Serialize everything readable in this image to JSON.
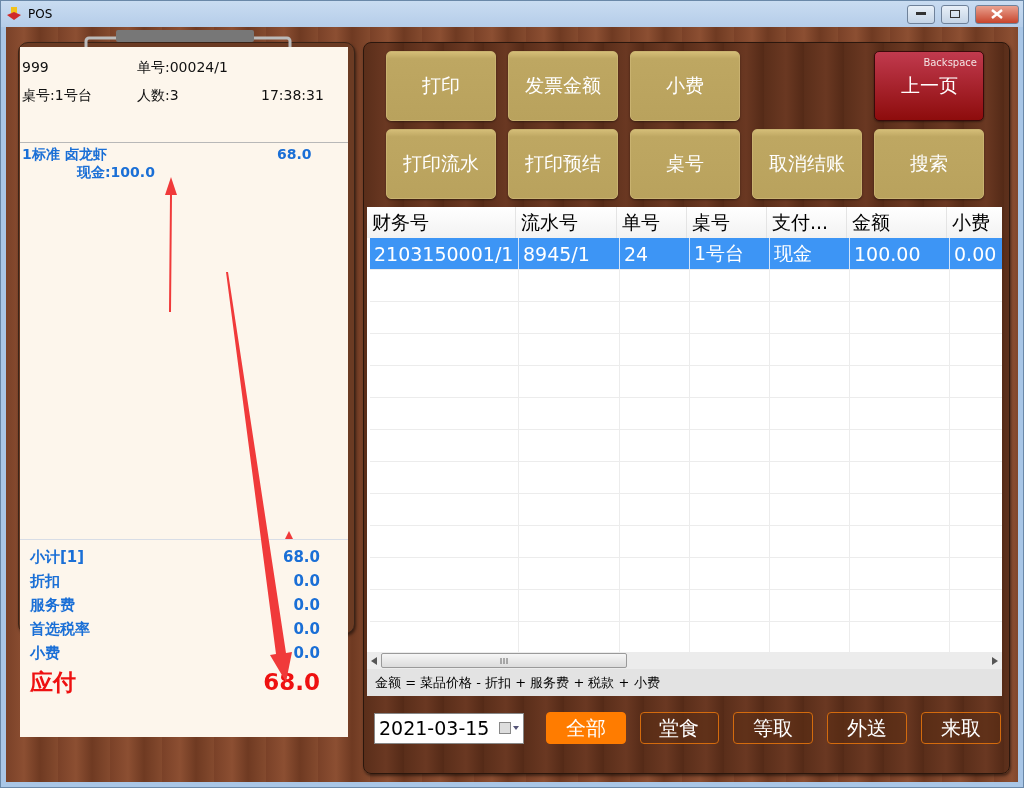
{
  "window": {
    "title": "POS"
  },
  "receipt": {
    "header": [
      {
        "text": "999"
      },
      {
        "text": "单号:00024/1"
      }
    ],
    "header_row_2": [
      "桌号:1号台",
      "人数:3",
      "17:38:31"
    ],
    "items": [
      {
        "name": "1标准 卤龙虾",
        "price": "68.0",
        "payment": "现金:100.0"
      }
    ],
    "totals": [
      {
        "label": "小计[1]",
        "value": "68.0"
      },
      {
        "label": "折扣",
        "value": "0.0"
      },
      {
        "label": "服务费",
        "value": "0.0"
      },
      {
        "label": "首选税率",
        "value": "0.0"
      },
      {
        "label": "小费",
        "value": "0.0"
      }
    ],
    "due": {
      "label": "应付",
      "value": "68.0"
    }
  },
  "buttons": [
    {
      "label": "打印",
      "kind": "normal"
    },
    {
      "label": "发票金额",
      "kind": "normal"
    },
    {
      "label": "小费",
      "kind": "normal"
    },
    {
      "kind": "gap"
    },
    {
      "label": "上一页",
      "kind": "danger",
      "hint": "Backspace"
    },
    {
      "label": "打印流水",
      "kind": "normal"
    },
    {
      "label": "打印预结",
      "kind": "normal"
    },
    {
      "label": "桌号",
      "kind": "normal"
    },
    {
      "label": "取消结账",
      "kind": "normal"
    },
    {
      "label": "搜索",
      "kind": "normal"
    }
  ],
  "table": {
    "columns": [
      "财务号",
      "流水号",
      "单号",
      "桌号",
      "支付...",
      "金额",
      "小费"
    ],
    "rows": [
      {
        "cells": [
          "2103150001/1",
          "8945/1",
          "24",
          "1号台",
          "现金",
          "100.00",
          "0.00"
        ],
        "selected": true
      }
    ]
  },
  "formula": "金额 = 菜品价格 - 折扣 + 服务费 + 税款 + 小费",
  "date": {
    "value": "2021-03-15"
  },
  "filters": [
    {
      "label": "全部",
      "selected": true
    },
    {
      "label": "堂食",
      "selected": false
    },
    {
      "label": "等取",
      "selected": false
    },
    {
      "label": "外送",
      "selected": false
    },
    {
      "label": "来取",
      "selected": false
    }
  ]
}
